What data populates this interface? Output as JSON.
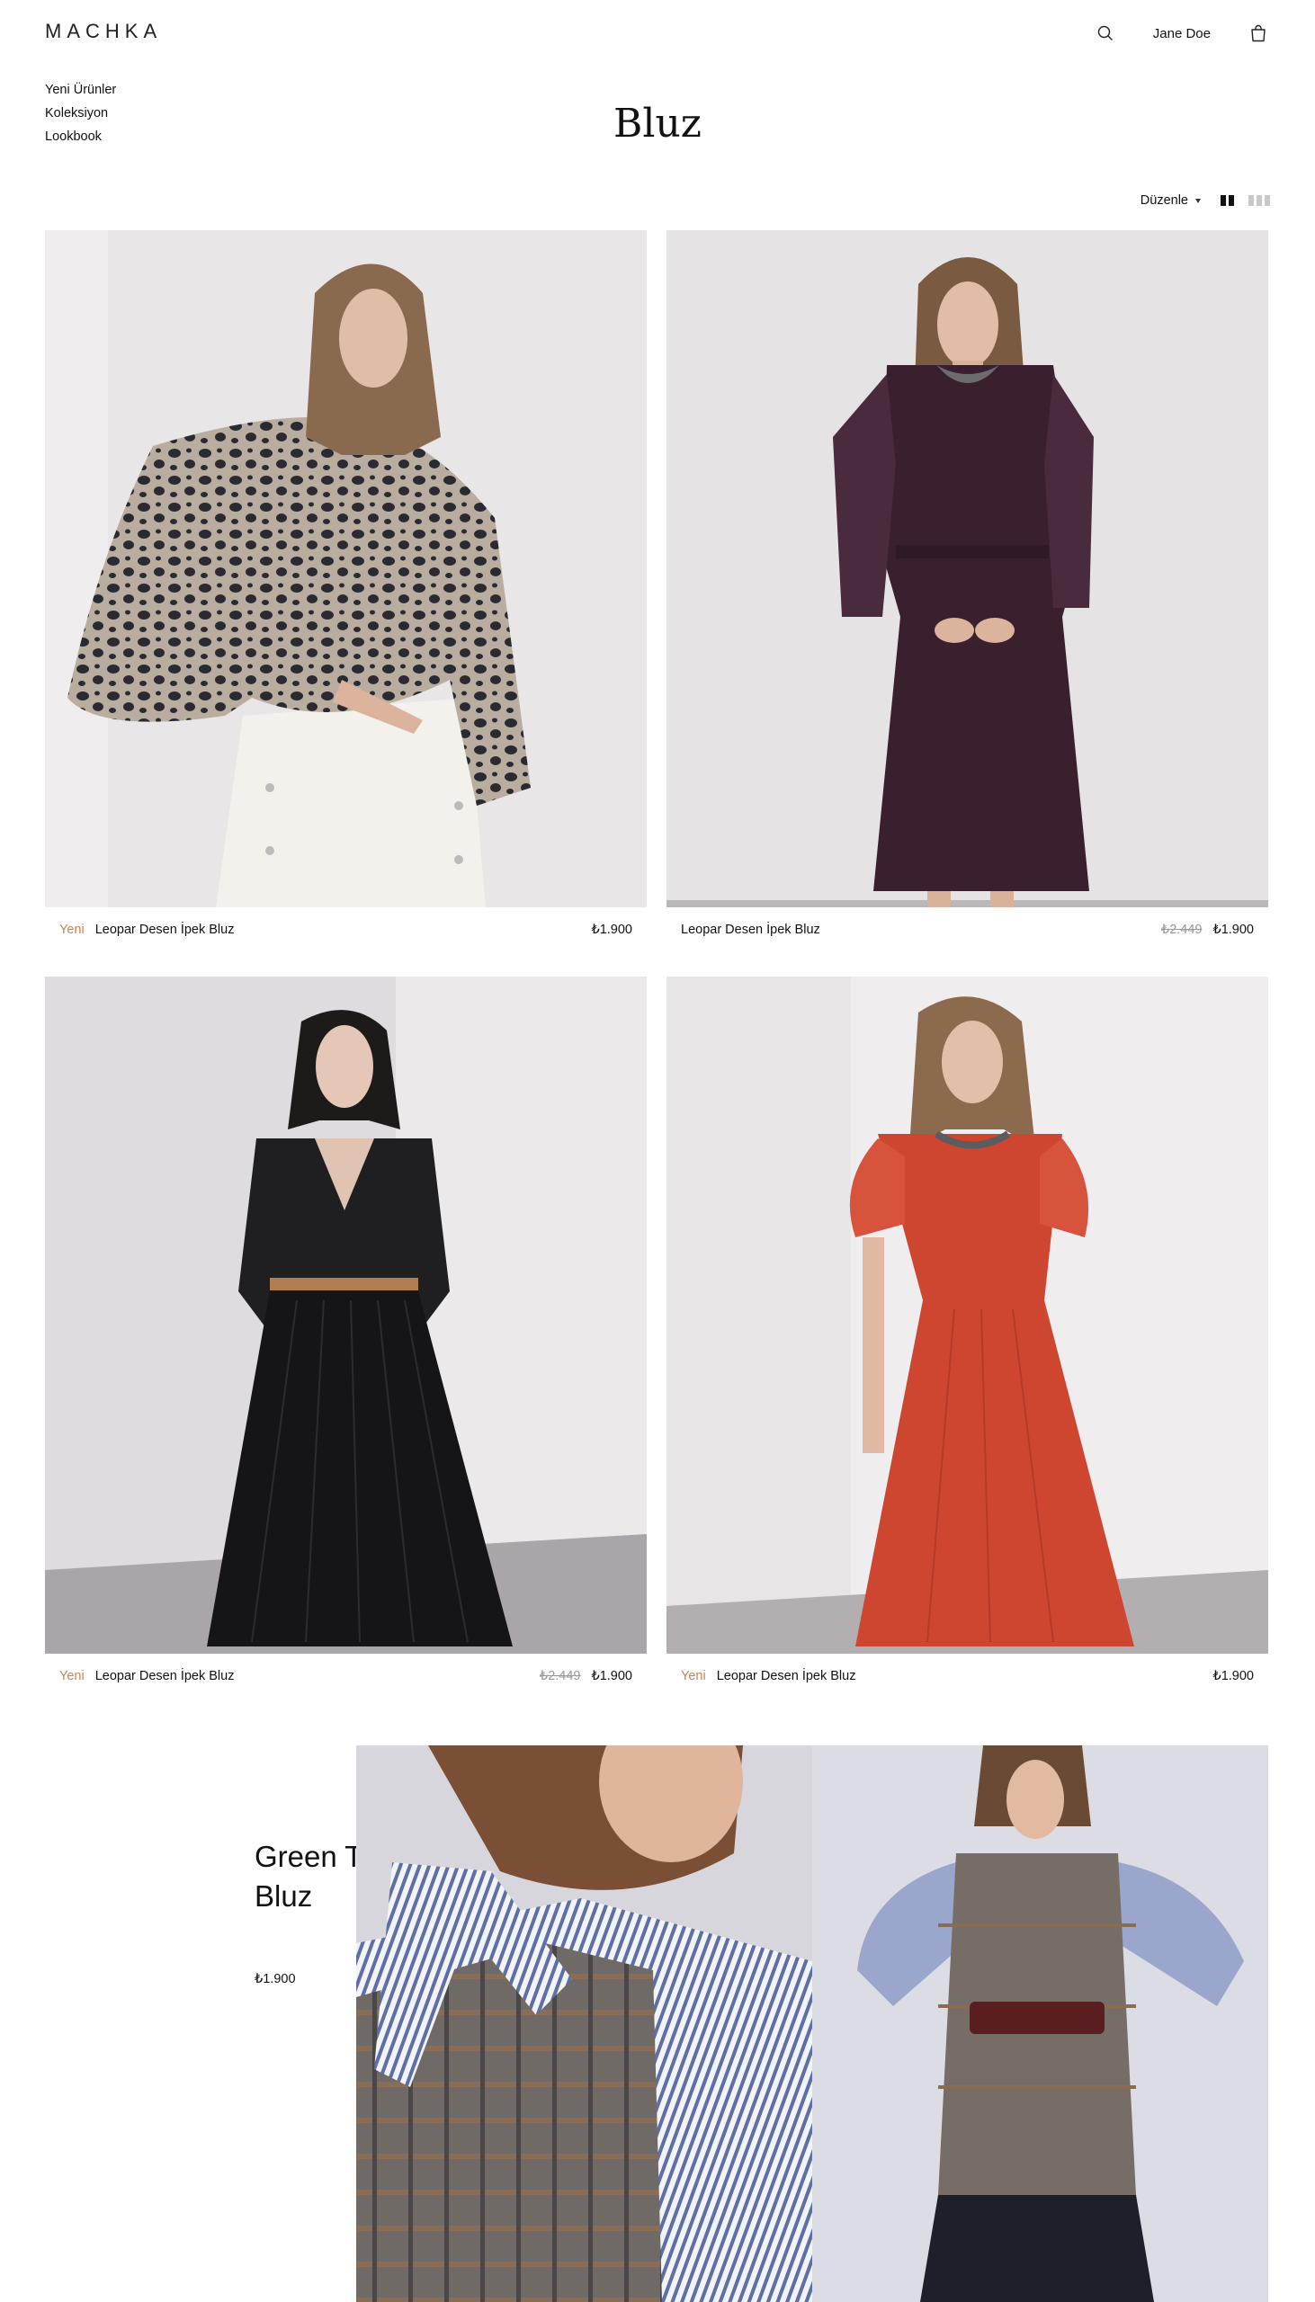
{
  "header": {
    "logo": "MACHKA",
    "search_icon": "search-icon",
    "user_name": "Jane Doe",
    "cart_icon": "shopping-bag-icon"
  },
  "nav": {
    "items": [
      {
        "label": "Yeni Ürünler"
      },
      {
        "label": "Koleksiyon"
      },
      {
        "label": "Lookbook"
      }
    ]
  },
  "page": {
    "title": "Bluz"
  },
  "toolbar": {
    "sort_label": "Düzenle",
    "view_two_icon": "two-column-grid-icon",
    "view_three_icon": "three-column-grid-icon"
  },
  "products": [
    {
      "badge": "Yeni",
      "name": "Leopar Desen İpek Bluz",
      "old_price": "",
      "price": "₺1.900"
    },
    {
      "badge": "",
      "name": "Leopar Desen İpek Bluz",
      "old_price": "₺2.449",
      "price": "₺1.900"
    },
    {
      "badge": "Yeni",
      "name": "Leopar Desen İpek Bluz",
      "old_price": "₺2.449",
      "price": "₺1.900"
    },
    {
      "badge": "Yeni",
      "name": "Leopar Desen İpek Bluz",
      "old_price": "",
      "price": "₺1.900"
    }
  ],
  "feature": {
    "title_line1": "Green Twill",
    "title_line2": "Bluz",
    "price": "₺1.900"
  },
  "colors": {
    "badge": "#c8844f",
    "text": "#111111",
    "muted": "#999999"
  }
}
